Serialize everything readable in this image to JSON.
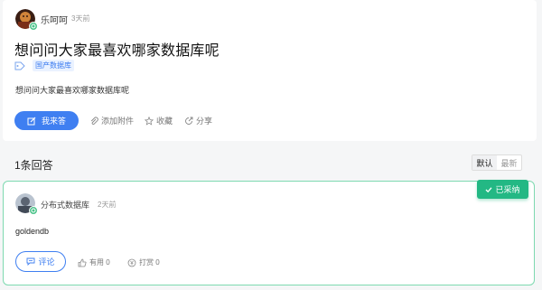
{
  "question": {
    "author": "乐呵呵",
    "time": "3天前",
    "title": "想问问大家最喜欢哪家数据库呢",
    "tag": "国产数据库",
    "body": "想问问大家最喜欢哪家数据库呢",
    "answer_button": "我来答",
    "actions": {
      "attach": "添加附件",
      "favorite": "收藏",
      "share": "分享"
    }
  },
  "answers_header": {
    "count_label": "1条回答",
    "sort_default": "默认",
    "sort_latest": "最新"
  },
  "answer": {
    "author": "分布式数据库",
    "time": "2天前",
    "body": "goldendb",
    "accepted_label": "已采纳",
    "comment_button": "评论",
    "useful_label": "有用 0",
    "tip_label": "打赏 0"
  },
  "colors": {
    "primary": "#3f7ff1",
    "accepted": "#23b884",
    "answer_border": "#7ed9b0"
  },
  "icons": {
    "tag": "tag-icon",
    "answer": "edit-icon",
    "attach": "paperclip-icon",
    "favorite": "star-icon",
    "share": "share-icon",
    "accepted": "check-icon",
    "comment": "comment-icon",
    "useful": "thumbs-up-icon",
    "tip": "coin-icon"
  }
}
